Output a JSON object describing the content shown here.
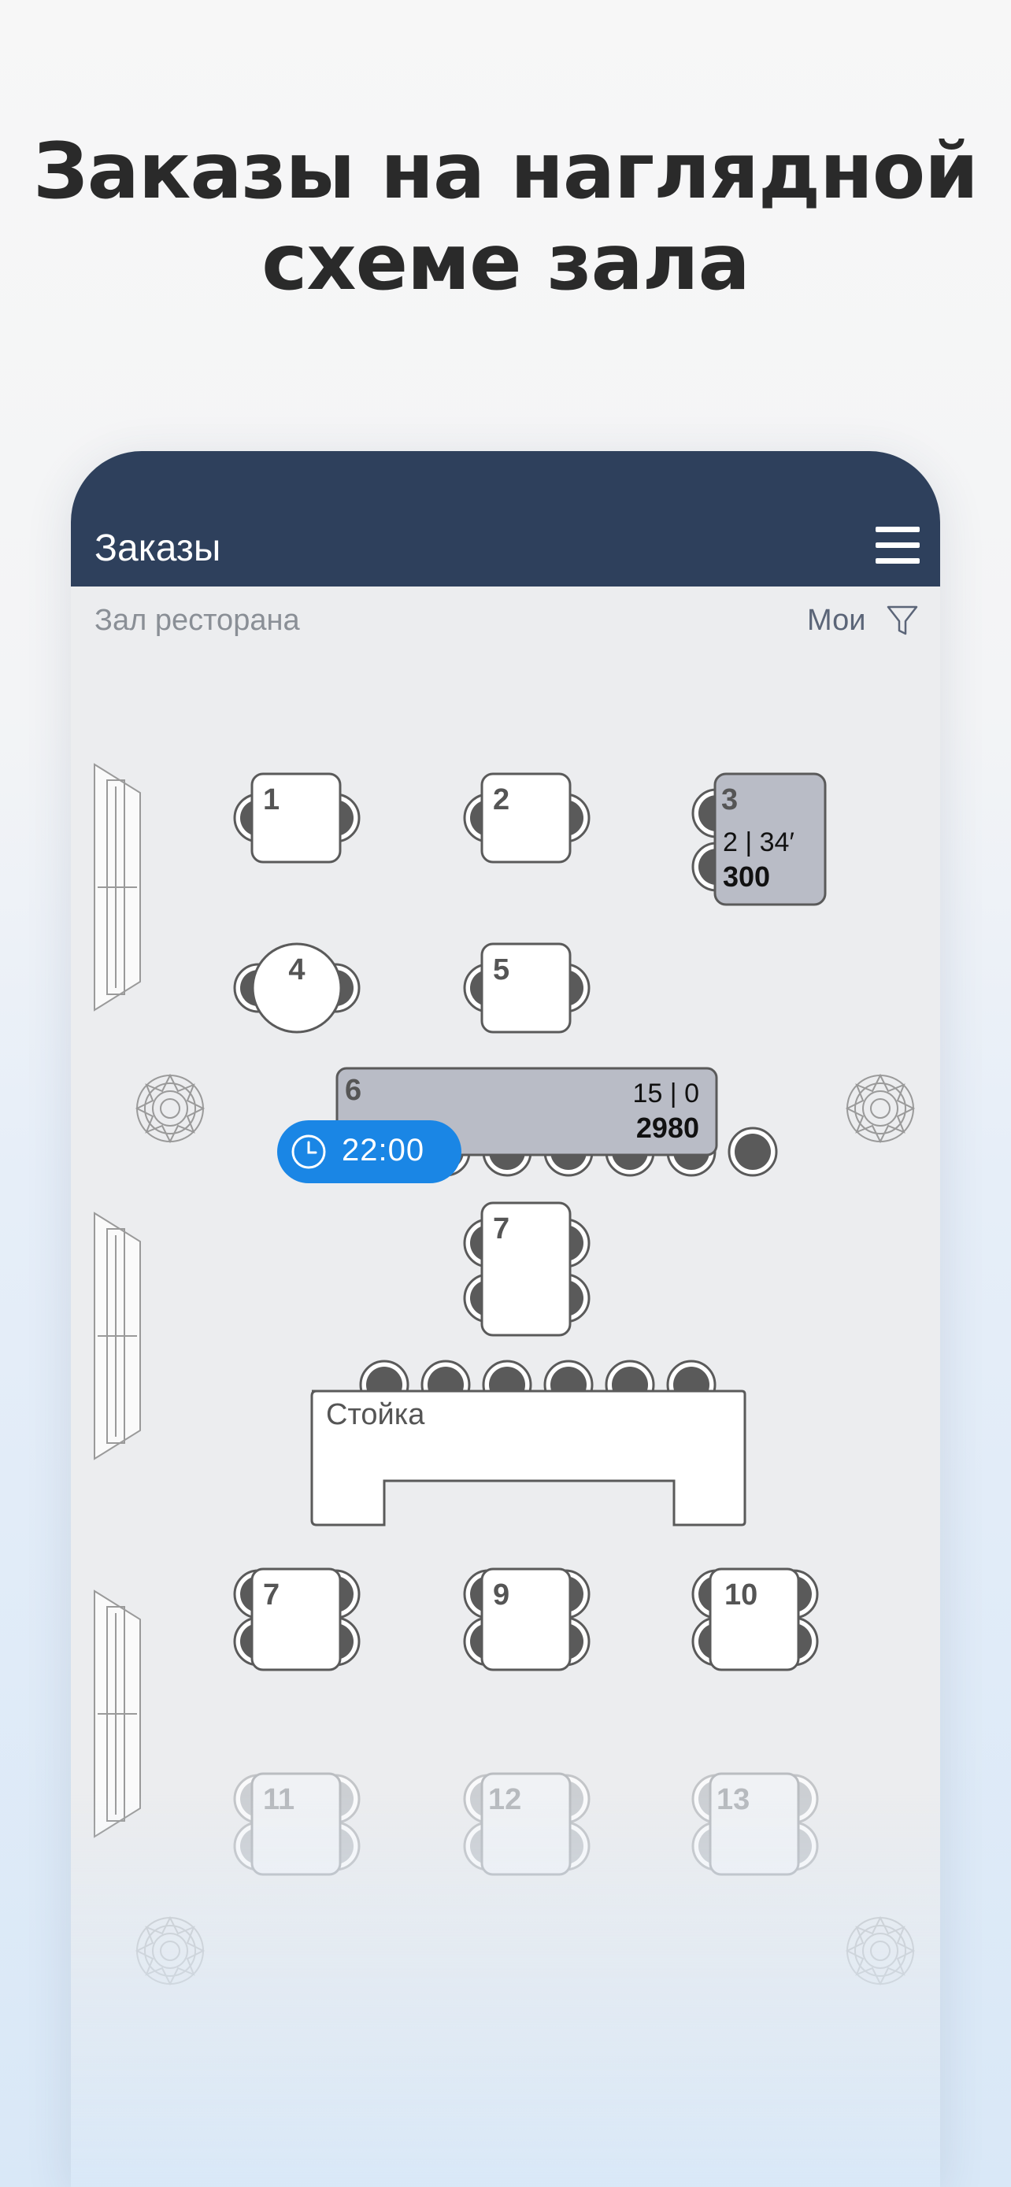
{
  "headline": {
    "line1": "Заказы на наглядной",
    "line2": "схеме зала"
  },
  "app": {
    "title": "Заказы",
    "menu_icon": "hamburger-menu-icon",
    "hall_name": "Зал ресторана",
    "filter_label": "Мои",
    "filter_icon": "filter-funnel-icon",
    "accent_color": "#2e405c"
  },
  "tables": {
    "t1": {
      "number": "1"
    },
    "t2": {
      "number": "2"
    },
    "t3": {
      "number": "3",
      "guests_time": "2 | 34′",
      "amount": "300"
    },
    "t4": {
      "number": "4"
    },
    "t5": {
      "number": "5"
    },
    "t6": {
      "number": "6",
      "guests_orders": "15 | 0",
      "amount": "2980",
      "reservation_time": "22:00"
    },
    "t7a": {
      "number": "7"
    },
    "t7b": {
      "number": "7"
    },
    "t9": {
      "number": "9"
    },
    "t10": {
      "number": "10"
    },
    "t11": {
      "number": "11"
    },
    "t12": {
      "number": "12"
    },
    "t13": {
      "number": "13"
    }
  },
  "counter": {
    "label": "Стойка"
  },
  "colors": {
    "occupied_table": "#b9bcc6",
    "free_table": "#ffffff",
    "reservation_chip": "#1a86e5",
    "chair": "#5a5a5a"
  }
}
